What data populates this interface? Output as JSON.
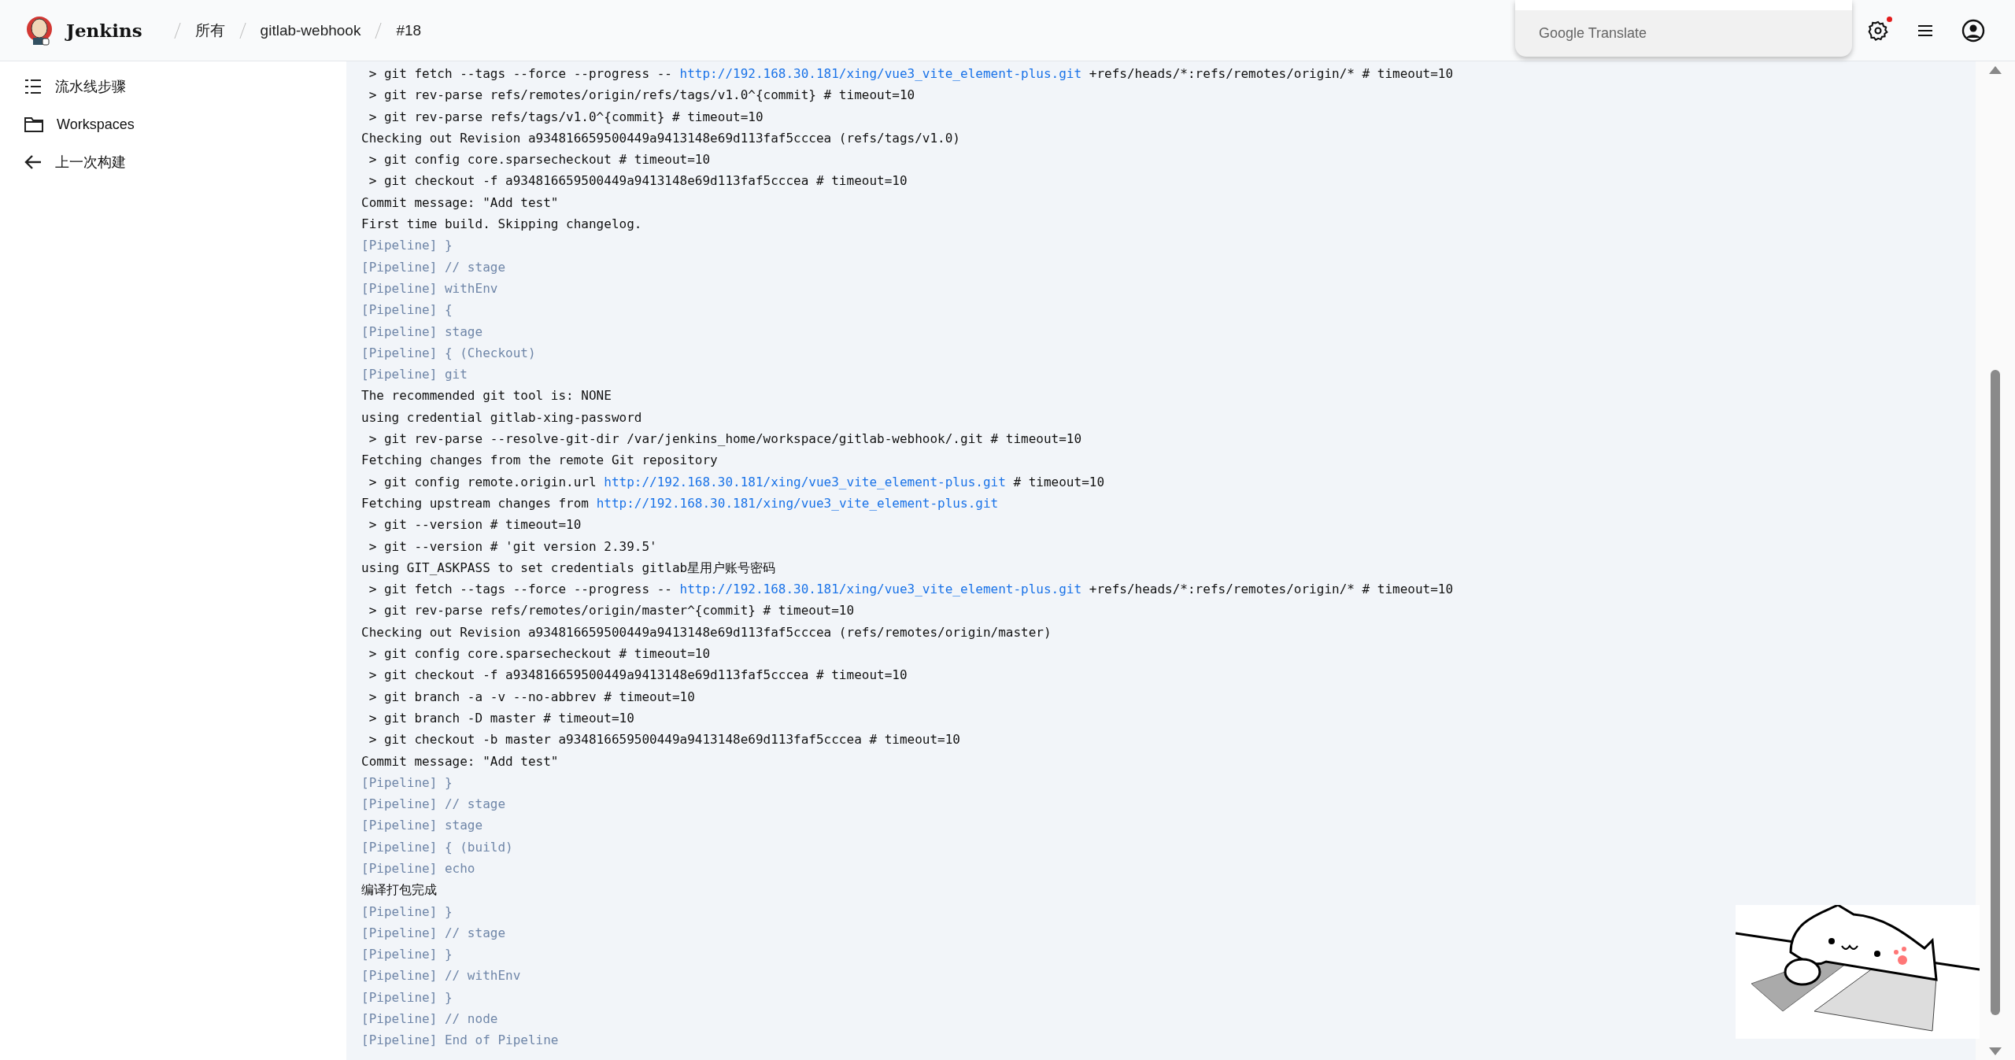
{
  "header": {
    "app_name": "Jenkins",
    "breadcrumbs": [
      "所有",
      "gitlab-webhook",
      "#18"
    ],
    "settings_notification": true
  },
  "translate_popup": {
    "label": "Google Translate"
  },
  "sidebar": {
    "items": [
      {
        "label": "流水线步骤"
      },
      {
        "label": "Workspaces"
      },
      {
        "label": "上一次构建"
      }
    ]
  },
  "console": {
    "lines": [
      {
        "kind": "output",
        "parts": [
          {
            "kind": "text",
            "text": " > git fetch --tags --force --progress -- "
          },
          {
            "kind": "link",
            "text": "http://192.168.30.181/xing/vue3_vite_element-plus.git"
          },
          {
            "kind": "text",
            "text": " +refs/heads/*:refs/remotes/origin/* # timeout=10"
          }
        ]
      },
      {
        "kind": "output",
        "parts": [
          {
            "kind": "text",
            "text": " > git rev-parse refs/remotes/origin/refs/tags/v1.0^{commit} # timeout=10"
          }
        ]
      },
      {
        "kind": "output",
        "parts": [
          {
            "kind": "text",
            "text": " > git rev-parse refs/tags/v1.0^{commit} # timeout=10"
          }
        ]
      },
      {
        "kind": "output",
        "parts": [
          {
            "kind": "text",
            "text": "Checking out Revision a934816659500449a9413148e69d113faf5cccea (refs/tags/v1.0)"
          }
        ]
      },
      {
        "kind": "output",
        "parts": [
          {
            "kind": "text",
            "text": " > git config core.sparsecheckout # timeout=10"
          }
        ]
      },
      {
        "kind": "output",
        "parts": [
          {
            "kind": "text",
            "text": " > git checkout -f a934816659500449a9413148e69d113faf5cccea # timeout=10"
          }
        ]
      },
      {
        "kind": "output",
        "parts": [
          {
            "kind": "text",
            "text": "Commit message: \"Add test\""
          }
        ]
      },
      {
        "kind": "output",
        "parts": [
          {
            "kind": "text",
            "text": "First time build. Skipping changelog."
          }
        ]
      },
      {
        "kind": "pipeline",
        "parts": [
          {
            "kind": "text",
            "text": "[Pipeline] }"
          }
        ]
      },
      {
        "kind": "pipeline",
        "parts": [
          {
            "kind": "text",
            "text": "[Pipeline] // stage"
          }
        ]
      },
      {
        "kind": "pipeline",
        "parts": [
          {
            "kind": "text",
            "text": "[Pipeline] withEnv"
          }
        ]
      },
      {
        "kind": "pipeline",
        "parts": [
          {
            "kind": "text",
            "text": "[Pipeline] {"
          }
        ]
      },
      {
        "kind": "pipeline",
        "parts": [
          {
            "kind": "text",
            "text": "[Pipeline] stage"
          }
        ]
      },
      {
        "kind": "pipeline",
        "parts": [
          {
            "kind": "text",
            "text": "[Pipeline] { (Checkout)"
          }
        ]
      },
      {
        "kind": "pipeline",
        "parts": [
          {
            "kind": "text",
            "text": "[Pipeline] git"
          }
        ]
      },
      {
        "kind": "output",
        "parts": [
          {
            "kind": "text",
            "text": "The recommended git tool is: NONE"
          }
        ]
      },
      {
        "kind": "output",
        "parts": [
          {
            "kind": "text",
            "text": "using credential gitlab-xing-password"
          }
        ]
      },
      {
        "kind": "output",
        "parts": [
          {
            "kind": "text",
            "text": " > git rev-parse --resolve-git-dir /var/jenkins_home/workspace/gitlab-webhook/.git # timeout=10"
          }
        ]
      },
      {
        "kind": "output",
        "parts": [
          {
            "kind": "text",
            "text": "Fetching changes from the remote Git repository"
          }
        ]
      },
      {
        "kind": "output",
        "parts": [
          {
            "kind": "text",
            "text": " > git config remote.origin.url "
          },
          {
            "kind": "link",
            "text": "http://192.168.30.181/xing/vue3_vite_element-plus.git"
          },
          {
            "kind": "text",
            "text": " # timeout=10"
          }
        ]
      },
      {
        "kind": "output",
        "parts": [
          {
            "kind": "text",
            "text": "Fetching upstream changes from "
          },
          {
            "kind": "link",
            "text": "http://192.168.30.181/xing/vue3_vite_element-plus.git"
          }
        ]
      },
      {
        "kind": "output",
        "parts": [
          {
            "kind": "text",
            "text": " > git --version # timeout=10"
          }
        ]
      },
      {
        "kind": "output",
        "parts": [
          {
            "kind": "text",
            "text": " > git --version # 'git version 2.39.5'"
          }
        ]
      },
      {
        "kind": "output",
        "parts": [
          {
            "kind": "text",
            "text": "using GIT_ASKPASS to set credentials gitlab星用户账号密码"
          }
        ]
      },
      {
        "kind": "output",
        "parts": [
          {
            "kind": "text",
            "text": " > git fetch --tags --force --progress -- "
          },
          {
            "kind": "link",
            "text": "http://192.168.30.181/xing/vue3_vite_element-plus.git"
          },
          {
            "kind": "text",
            "text": " +refs/heads/*:refs/remotes/origin/* # timeout=10"
          }
        ]
      },
      {
        "kind": "output",
        "parts": [
          {
            "kind": "text",
            "text": " > git rev-parse refs/remotes/origin/master^{commit} # timeout=10"
          }
        ]
      },
      {
        "kind": "output",
        "parts": [
          {
            "kind": "text",
            "text": "Checking out Revision a934816659500449a9413148e69d113faf5cccea (refs/remotes/origin/master)"
          }
        ]
      },
      {
        "kind": "output",
        "parts": [
          {
            "kind": "text",
            "text": " > git config core.sparsecheckout # timeout=10"
          }
        ]
      },
      {
        "kind": "output",
        "parts": [
          {
            "kind": "text",
            "text": " > git checkout -f a934816659500449a9413148e69d113faf5cccea # timeout=10"
          }
        ]
      },
      {
        "kind": "output",
        "parts": [
          {
            "kind": "text",
            "text": " > git branch -a -v --no-abbrev # timeout=10"
          }
        ]
      },
      {
        "kind": "output",
        "parts": [
          {
            "kind": "text",
            "text": " > git branch -D master # timeout=10"
          }
        ]
      },
      {
        "kind": "output",
        "parts": [
          {
            "kind": "text",
            "text": " > git checkout -b master a934816659500449a9413148e69d113faf5cccea # timeout=10"
          }
        ]
      },
      {
        "kind": "output",
        "parts": [
          {
            "kind": "text",
            "text": "Commit message: \"Add test\""
          }
        ]
      },
      {
        "kind": "pipeline",
        "parts": [
          {
            "kind": "text",
            "text": "[Pipeline] }"
          }
        ]
      },
      {
        "kind": "pipeline",
        "parts": [
          {
            "kind": "text",
            "text": "[Pipeline] // stage"
          }
        ]
      },
      {
        "kind": "pipeline",
        "parts": [
          {
            "kind": "text",
            "text": "[Pipeline] stage"
          }
        ]
      },
      {
        "kind": "pipeline",
        "parts": [
          {
            "kind": "text",
            "text": "[Pipeline] { (build)"
          }
        ]
      },
      {
        "kind": "pipeline",
        "parts": [
          {
            "kind": "text",
            "text": "[Pipeline] echo"
          }
        ]
      },
      {
        "kind": "output",
        "parts": [
          {
            "kind": "text",
            "text": "编译打包完成"
          }
        ]
      },
      {
        "kind": "pipeline",
        "parts": [
          {
            "kind": "text",
            "text": "[Pipeline] }"
          }
        ]
      },
      {
        "kind": "pipeline",
        "parts": [
          {
            "kind": "text",
            "text": "[Pipeline] // stage"
          }
        ]
      },
      {
        "kind": "pipeline",
        "parts": [
          {
            "kind": "text",
            "text": "[Pipeline] }"
          }
        ]
      },
      {
        "kind": "pipeline",
        "parts": [
          {
            "kind": "text",
            "text": "[Pipeline] // withEnv"
          }
        ]
      },
      {
        "kind": "pipeline",
        "parts": [
          {
            "kind": "text",
            "text": "[Pipeline] }"
          }
        ]
      },
      {
        "kind": "pipeline",
        "parts": [
          {
            "kind": "text",
            "text": "[Pipeline] // node"
          }
        ]
      },
      {
        "kind": "pipeline",
        "parts": [
          {
            "kind": "text",
            "text": "[Pipeline] End of Pipeline"
          }
        ]
      }
    ]
  }
}
